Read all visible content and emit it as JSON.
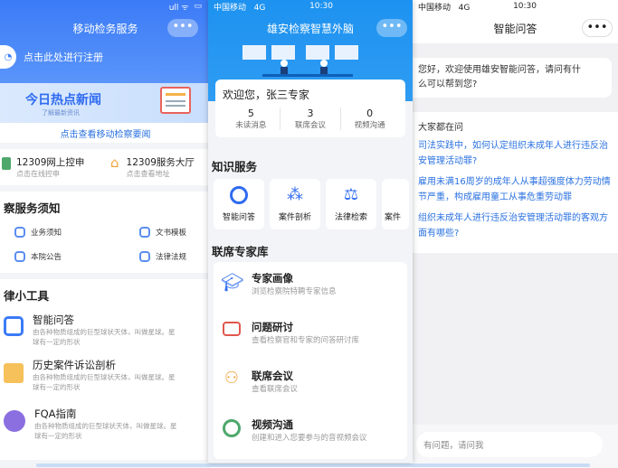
{
  "left": {
    "status": {
      "signal": "ull ᯤ",
      "battery": "▭"
    },
    "title": "移动检务服务",
    "caps_label": "•••",
    "register": "点击此处进行注册",
    "banner": {
      "title": "今日热点新闻",
      "sub": "了解最新资讯"
    },
    "news_link": "点击查看移动检察要闻",
    "shortcuts": [
      {
        "label": "12309网上控申",
        "sub": "点击在线控申"
      },
      {
        "label": "12309服务大厅",
        "sub": "点击查看地址"
      }
    ],
    "notice_title": "察服务须知",
    "notice_items": [
      "业务须知",
      "文书模板",
      "本院公告",
      "法律法规"
    ],
    "tools_title": "律小工具",
    "tools": [
      {
        "label": "智能问答",
        "desc1": "由各种物质组成的巨型球状天体，叫做星球。星",
        "desc2": "球有一定的形状"
      },
      {
        "label": "历史案件诉讼剖析",
        "desc1": "由各种物质组成的巨型球状天体，叫做星球。星",
        "desc2": "球有一定的形状"
      },
      {
        "label": "FQA指南",
        "desc1": "由各种物质组成的巨型球状天体，叫做星球。星",
        "desc2": "球有一定的形状"
      }
    ]
  },
  "middle": {
    "status": {
      "carrier": "中国移动",
      "network": "4G",
      "time": "10:30"
    },
    "title": "雄安检察智慧外脑",
    "caps_label": "•••",
    "welcome": "欢迎您，张三专家",
    "stats": [
      {
        "value": "5",
        "label": "未读消息"
      },
      {
        "value": "3",
        "label": "联席会议"
      },
      {
        "value": "0",
        "label": "视频沟通"
      }
    ],
    "knowledge_title": "知识服务",
    "knowledge_items": [
      "智能问答",
      "案件剖析",
      "法律检索",
      "案件"
    ],
    "experts_title": "联席专家库",
    "expert_items": [
      {
        "label": "专家画像",
        "desc": "浏览检察院特聘专家信息"
      },
      {
        "label": "问题研讨",
        "desc": "查看检察官和专家的问答研讨库"
      },
      {
        "label": "联席会议",
        "desc": "查看联席会议"
      },
      {
        "label": "视频沟通",
        "desc": "创建和进入您要参与的音视频会议"
      }
    ]
  },
  "right": {
    "status": {
      "carrier": "中国移动",
      "network": "4G",
      "time": "10:30"
    },
    "title": "智能问答",
    "caps_label": "•••",
    "greeting": [
      "您好，欢迎使用雄安智能问答，请问有什",
      "么可以帮到您?"
    ],
    "faq_title": "大家都在问",
    "faqs": [
      [
        "司法实践中，如何认定组织未成年人进行违反治",
        "安管理活动罪?"
      ],
      [
        "雇用未满16周岁的成年人从事超强度体力劳动情",
        "节严重，构成雇用童工从事危重劳动罪"
      ],
      [
        "组织未成年人进行违反治安管理活动罪的客观方",
        "面有哪些?"
      ]
    ],
    "input_placeholder": "有问题，请问我"
  },
  "colors": {
    "primary": "#2f6bf0",
    "link": "#2b72e0",
    "orange": "#f2a33a",
    "purple": "#8b6fe0"
  }
}
